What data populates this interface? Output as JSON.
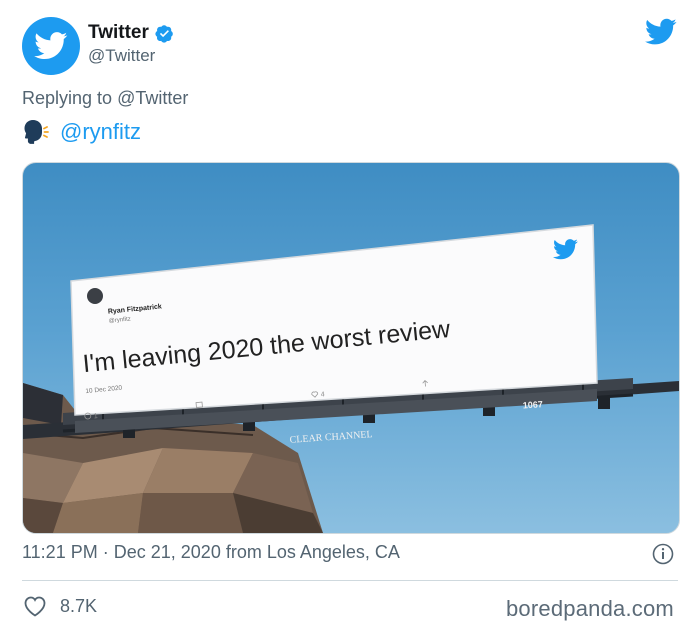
{
  "author": {
    "display_name": "Twitter",
    "handle": "@Twitter",
    "verified": true,
    "avatar_color": "#1d9bf0"
  },
  "reply": {
    "prefix": "Replying to",
    "to_handle": "@Twitter",
    "mention": "@rynfitz"
  },
  "billboard": {
    "author_name": "Ryan Fitzpatrick",
    "author_handle": "@rynfitz",
    "text": "I'm leaving 2020 the worst review",
    "date": "10 Dec 2020",
    "comments": "1",
    "likes": "4",
    "brand": "CLEAR CHANNEL",
    "panel_number": "1067"
  },
  "meta": {
    "time": "11:21 PM",
    "separator": "·",
    "date": "Dec 21, 2020",
    "source": "from Los Angeles, CA"
  },
  "footer": {
    "like_count": "8.7K",
    "watermark": "boredpanda.com"
  },
  "colors": {
    "accent": "#1d9bf0",
    "secondary_text": "#536471"
  }
}
